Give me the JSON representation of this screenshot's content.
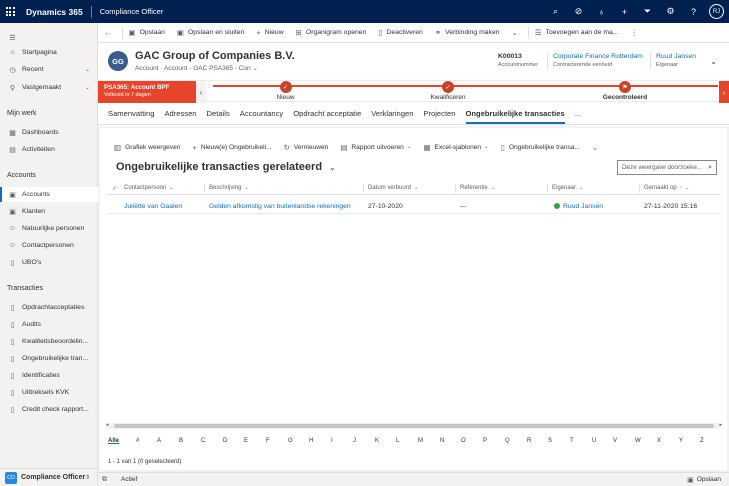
{
  "topbar": {
    "brand": "Dynamics 365",
    "app_name": "Compliance Officer",
    "avatar_initials": "RJ",
    "icons": [
      "search-icon",
      "task-icon",
      "lightbulb-icon",
      "plus-icon",
      "filter-icon",
      "gear-icon",
      "help-icon"
    ]
  },
  "sidebar": {
    "top_items": [
      {
        "label": "Startpagina",
        "icon": "home-icon"
      },
      {
        "label": "Recent",
        "icon": "clock-icon"
      },
      {
        "label": "Vastgemaakt",
        "icon": "pin-icon"
      }
    ],
    "groups": [
      {
        "title": "Mijn werk",
        "items": [
          "Dashboards",
          "Activiteiten"
        ]
      },
      {
        "title": "Accounts",
        "items": [
          "Accounts",
          "Klanten",
          "Natuurlijke personen",
          "Contactpersonen",
          "UBO's"
        ]
      },
      {
        "title": "Transacties",
        "items": [
          "Opdrachtacceptaties",
          "Audits",
          "Kwaliteitsbeoordelin...",
          "Ongebruikelijke tran...",
          "Identificaties",
          "Uittreksels KVK",
          "Credit check rapport..."
        ]
      }
    ],
    "active_item": "Accounts",
    "footer": {
      "badge": "CO",
      "label": "Compliance Officer"
    }
  },
  "command_bar": {
    "items": [
      {
        "label": "Opslaan",
        "icon": "save-icon"
      },
      {
        "label": "Opslaan en sluiten",
        "icon": "save-close-icon"
      },
      {
        "label": "Nieuw",
        "icon": "plus-icon"
      },
      {
        "label": "Organigram openen",
        "icon": "org-chart-icon"
      },
      {
        "label": "Deactiveren",
        "icon": "deactivate-icon"
      },
      {
        "label": "Verbinding maken",
        "icon": "connect-icon"
      },
      {
        "label": "Toevoegen aan de ma...",
        "icon": "list-add-icon"
      }
    ]
  },
  "header": {
    "initials": "GG",
    "title": "GAC Group of Companies B.V.",
    "subtitle_entity": "Account",
    "subtitle_form": "Account - GAC PSA365 - Con",
    "fields": [
      {
        "value": "K00013",
        "label": "Accountnummer",
        "link": false
      },
      {
        "value": "Corporate Finance Rotterdam",
        "label": "Contracterende eenheid",
        "link": true
      },
      {
        "value": "Ruud Jansen",
        "label": "Eigenaar",
        "link": true
      }
    ]
  },
  "bpf": {
    "name": "PSA365: Account BPF",
    "status": "Voltooid in 7 dagen",
    "stages": [
      "Nieuw",
      "Kwalificeren",
      "Gecontroleerd"
    ]
  },
  "tabs": [
    "Samenvatting",
    "Adressen",
    "Details",
    "Accountancy",
    "Opdracht acceptatie",
    "Verklaringen",
    "Projecten",
    "Ongebruikelijke transacties",
    "..."
  ],
  "active_tab": "Ongebruikelijke transacties",
  "subgrid": {
    "commands": [
      {
        "label": "Grafiek weergeven",
        "icon": "chart-icon",
        "dropdown": false
      },
      {
        "label": "Nieuw(e) Ongebruikeli...",
        "icon": "plus-icon",
        "dropdown": false
      },
      {
        "label": "Vernieuwen",
        "icon": "refresh-icon",
        "dropdown": false
      },
      {
        "label": "Rapport uitvoeren",
        "icon": "report-icon",
        "dropdown": true
      },
      {
        "label": "Excel-sjablonen",
        "icon": "excel-icon",
        "dropdown": true
      },
      {
        "label": "Ongebruikelijke transa...",
        "icon": "document-icon",
        "dropdown": false
      }
    ],
    "view_title": "Ongebruikelijke transacties gerelateerd",
    "search_placeholder": "Deze weergave doorzoeke...",
    "columns": [
      "Contactpersoon",
      "Beschrijving",
      "Datum verbuurd",
      "Referentie",
      "Eigenaar",
      "Gemaakt op"
    ],
    "rows": [
      {
        "contact": "Juliëtte van Gaalen",
        "description": "Gelden afkomstig van buitenlandse rekeningen",
        "date": "27-10-2020",
        "reference": "---",
        "owner": "Ruud Jansen",
        "created": "27-11-2020 15:16"
      }
    ],
    "alphabet": [
      "Alle",
      "#",
      "A",
      "B",
      "C",
      "D",
      "E",
      "F",
      "G",
      "H",
      "I",
      "J",
      "K",
      "L",
      "M",
      "N",
      "O",
      "P",
      "Q",
      "R",
      "S",
      "T",
      "U",
      "V",
      "W",
      "X",
      "Y",
      "Z"
    ],
    "record_count": "1 - 1 van 1 (0 geselecteerd)"
  },
  "footer": {
    "status": "Actief",
    "save_label": "Opslaan"
  },
  "colors": {
    "topbar": "#002050",
    "accent": "#106ebe",
    "bpf": "#e6452b"
  }
}
